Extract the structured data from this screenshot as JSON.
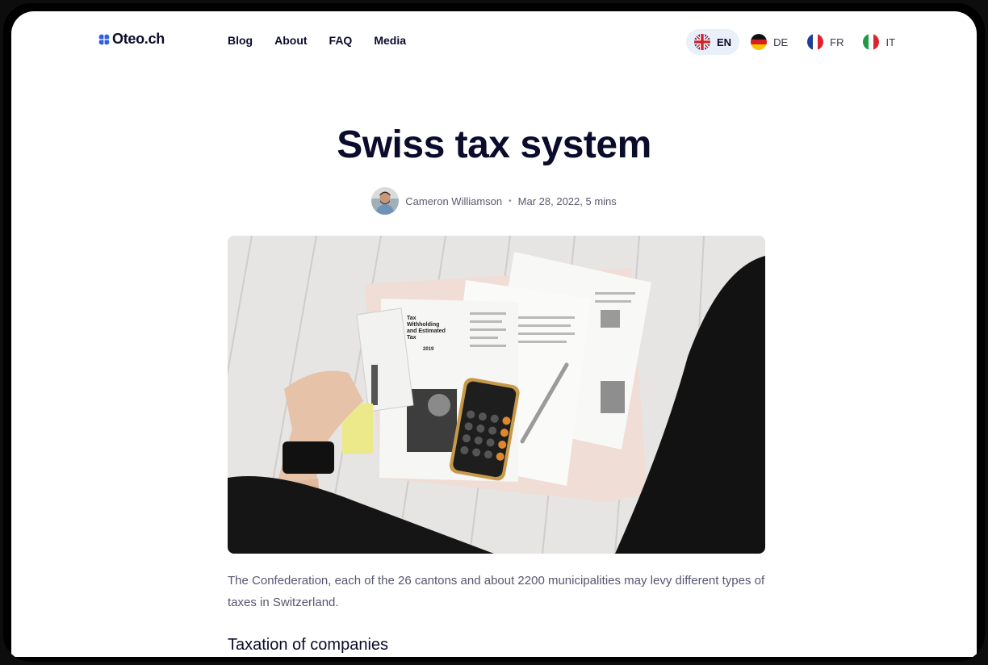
{
  "header": {
    "logo_text": "Oteo.ch",
    "nav": [
      "Blog",
      "About",
      "FAQ",
      "Media"
    ],
    "languages": [
      {
        "code": "EN",
        "flag": "uk-flag-icon",
        "active": true
      },
      {
        "code": "DE",
        "flag": "germany-flag-icon",
        "active": false
      },
      {
        "code": "FR",
        "flag": "france-flag-icon",
        "active": false
      },
      {
        "code": "IT",
        "flag": "italy-flag-icon",
        "active": false
      }
    ]
  },
  "article": {
    "title": "Swiss tax system",
    "author": "Cameron Williamson",
    "separator": "•",
    "date_read": "Mar 28, 2022, 5 mins",
    "hero_image": "Tax documents with calculator and pen on a white wooden floor",
    "hero_doc_heading": "Tax Withholding and Estimated Tax",
    "hero_doc_year": "2019",
    "intro": "The Confederation, each of the 26 cantons and about 2200 municipalities may levy different types of taxes in Switzerland.",
    "section_heading": "Taxation of companies"
  },
  "colors": {
    "text_dark": "#0b0b2c",
    "text_muted": "#565670",
    "active_lang_bg": "#eaf0fa",
    "logo_blue": "#2f5fe0"
  }
}
